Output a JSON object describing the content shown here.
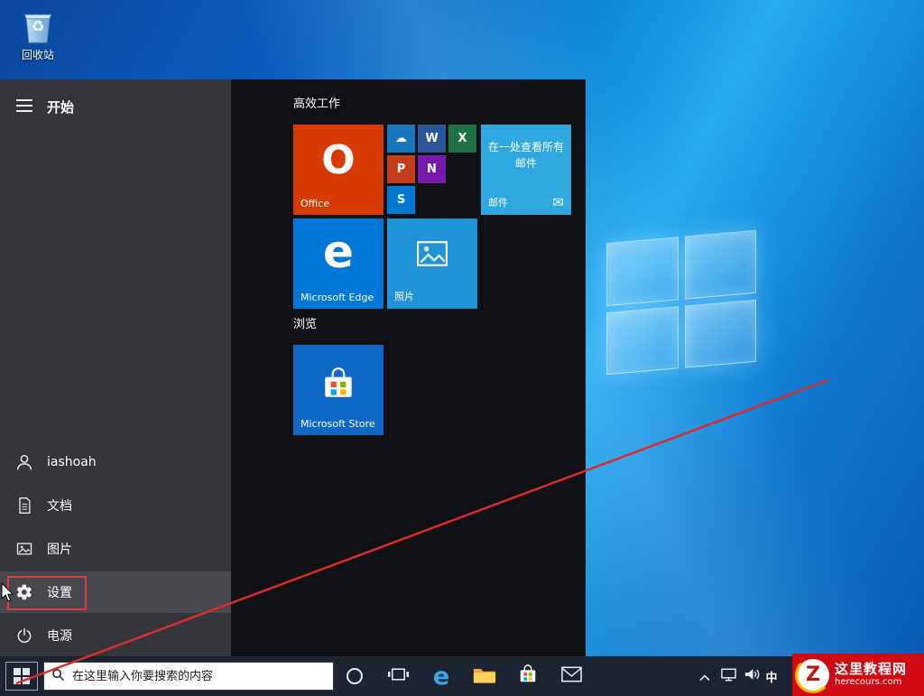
{
  "desktop": {
    "recycle_bin_label": "回收站",
    "recycle_glyph": "♻"
  },
  "start_menu": {
    "header": "开始",
    "rail_items": [
      {
        "label": "iashoah"
      },
      {
        "label": "文档"
      },
      {
        "label": "图片"
      },
      {
        "label": "设置"
      },
      {
        "label": "电源"
      }
    ],
    "group_titles": [
      "高效工作",
      "浏览"
    ],
    "tiles": {
      "office": {
        "label": "Office",
        "glyph": "O",
        "color": "#d83b01"
      },
      "mail": {
        "overlay_text": "在一处查看所有邮件",
        "label": "邮件",
        "icon_glyph": "✉",
        "color": "#2fa7df"
      },
      "edge": {
        "label": "Microsoft Edge",
        "glyph": "e",
        "color": "#0078d7"
      },
      "photos": {
        "label": "照片",
        "color": "#2193d8"
      },
      "store": {
        "label": "Microsoft Store",
        "color": "#0d68c6"
      }
    },
    "small_tiles": [
      {
        "name": "OneDrive",
        "glyph": "☁",
        "color": "#1878be"
      },
      {
        "name": "Word",
        "glyph": "W",
        "color": "#2b579a"
      },
      {
        "name": "Excel",
        "glyph": "X",
        "color": "#1e7145"
      },
      {
        "name": "PowerPoint",
        "glyph": "P",
        "color": "#c43e1c"
      },
      {
        "name": "OneNote",
        "glyph": "N",
        "color": "#7719aa"
      },
      {
        "name": "Skype",
        "glyph": "S",
        "color": "#0078d4"
      }
    ]
  },
  "taskbar": {
    "search_placeholder": "在这里输入你要搜索的内容",
    "ime_label": "中"
  },
  "watermark": {
    "logo_letter": "Z",
    "title": "这里教程网",
    "url": "herecours.com",
    "color": "#cf0a12"
  }
}
